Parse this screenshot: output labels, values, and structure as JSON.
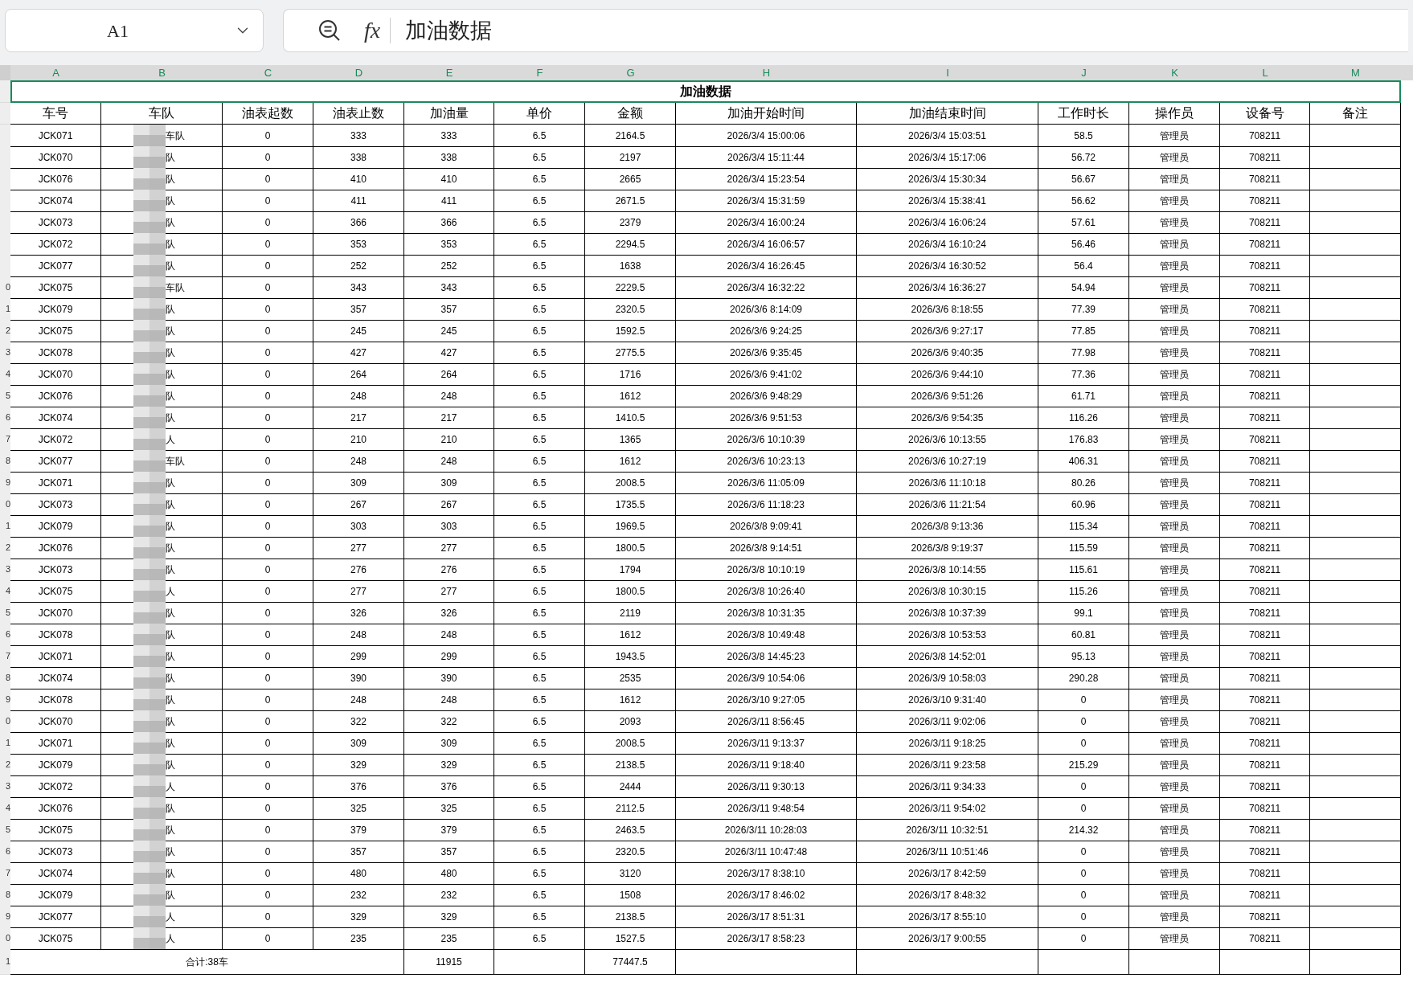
{
  "name_box": {
    "value": "A1"
  },
  "formula_bar": {
    "function_label": "fx",
    "value": "加油数据"
  },
  "column_letters": [
    {
      "label": "A",
      "selected": true
    },
    {
      "label": "B",
      "selected": true
    },
    {
      "label": "C",
      "selected": true
    },
    {
      "label": "D",
      "selected": true
    },
    {
      "label": "E",
      "selected": true
    },
    {
      "label": "F",
      "selected": true
    },
    {
      "label": "G",
      "selected": true
    },
    {
      "label": "H",
      "selected": true
    },
    {
      "label": "I",
      "selected": true
    },
    {
      "label": "J",
      "selected": true
    },
    {
      "label": "K",
      "selected": true
    },
    {
      "label": "L",
      "selected": true
    },
    {
      "label": "M",
      "selected": true
    }
  ],
  "title_row": {
    "text": "加油数据",
    "selected": true
  },
  "table": {
    "columns": [
      "车号",
      "车队",
      "油表起数",
      "油表止数",
      "加油量",
      "单价",
      "金额",
      "加油开始时间",
      "加油结束时间",
      "工作时长",
      "操作员",
      "设备号",
      "备注"
    ],
    "rows": [
      {
        "cells": [
          "JCK071",
          "车队",
          "0",
          "333",
          "333",
          "6.5",
          "2164.5",
          "2026/3/4 15:00:06",
          "2026/3/4 15:03:51",
          "58.5",
          "管理员",
          "708211"
        ]
      },
      {
        "cells": [
          "JCK070",
          "队",
          "0",
          "338",
          "338",
          "6.5",
          "2197",
          "2026/3/4 15:11:44",
          "2026/3/4 15:17:06",
          "56.72",
          "管理员",
          "708211"
        ]
      },
      {
        "cells": [
          "JCK076",
          "队",
          "0",
          "410",
          "410",
          "6.5",
          "2665",
          "2026/3/4 15:23:54",
          "2026/3/4 15:30:34",
          "56.67",
          "管理员",
          "708211"
        ]
      },
      {
        "cells": [
          "JCK074",
          "队",
          "0",
          "411",
          "411",
          "6.5",
          "2671.5",
          "2026/3/4 15:31:59",
          "2026/3/4 15:38:41",
          "56.62",
          "管理员",
          "708211"
        ]
      },
      {
        "cells": [
          "JCK073",
          "队",
          "0",
          "366",
          "366",
          "6.5",
          "2379",
          "2026/3/4 16:00:24",
          "2026/3/4 16:06:24",
          "57.61",
          "管理员",
          "708211"
        ]
      },
      {
        "cells": [
          "JCK072",
          "队",
          "0",
          "353",
          "353",
          "6.5",
          "2294.5",
          "2026/3/4 16:06:57",
          "2026/3/4 16:10:24",
          "56.46",
          "管理员",
          "708211"
        ]
      },
      {
        "cells": [
          "JCK077",
          "队",
          "0",
          "252",
          "252",
          "6.5",
          "1638",
          "2026/3/4 16:26:45",
          "2026/3/4 16:30:52",
          "56.4",
          "管理员",
          "708211"
        ]
      },
      {
        "row_label": "0",
        "cells": [
          "JCK075",
          "车队",
          "0",
          "343",
          "343",
          "6.5",
          "2229.5",
          "2026/3/4 16:32:22",
          "2026/3/4 16:36:27",
          "54.94",
          "管理员",
          "708211"
        ]
      },
      {
        "row_label": "1",
        "cells": [
          "JCK079",
          "队",
          "0",
          "357",
          "357",
          "6.5",
          "2320.5",
          "2026/3/6 8:14:09",
          "2026/3/6 8:18:55",
          "77.39",
          "管理员",
          "708211"
        ]
      },
      {
        "row_label": "2",
        "cells": [
          "JCK075",
          "队",
          "0",
          "245",
          "245",
          "6.5",
          "1592.5",
          "2026/3/6 9:24:25",
          "2026/3/6 9:27:17",
          "77.85",
          "管理员",
          "708211"
        ]
      },
      {
        "row_label": "3",
        "cells": [
          "JCK078",
          "队",
          "0",
          "427",
          "427",
          "6.5",
          "2775.5",
          "2026/3/6 9:35:45",
          "2026/3/6 9:40:35",
          "77.98",
          "管理员",
          "708211"
        ]
      },
      {
        "row_label": "4",
        "cells": [
          "JCK070",
          "队",
          "0",
          "264",
          "264",
          "6.5",
          "1716",
          "2026/3/6 9:41:02",
          "2026/3/6 9:44:10",
          "77.36",
          "管理员",
          "708211"
        ]
      },
      {
        "row_label": "5",
        "cells": [
          "JCK076",
          "队",
          "0",
          "248",
          "248",
          "6.5",
          "1612",
          "2026/3/6 9:48:29",
          "2026/3/6 9:51:26",
          "61.71",
          "管理员",
          "708211"
        ]
      },
      {
        "row_label": "6",
        "cells": [
          "JCK074",
          "队",
          "0",
          "217",
          "217",
          "6.5",
          "1410.5",
          "2026/3/6 9:51:53",
          "2026/3/6 9:54:35",
          "116.26",
          "管理员",
          "708211"
        ]
      },
      {
        "row_label": "7",
        "cells": [
          "JCK072",
          "人",
          "0",
          "210",
          "210",
          "6.5",
          "1365",
          "2026/3/6 10:10:39",
          "2026/3/6 10:13:55",
          "176.83",
          "管理员",
          "708211"
        ]
      },
      {
        "row_label": "8",
        "cells": [
          "JCK077",
          "车队",
          "0",
          "248",
          "248",
          "6.5",
          "1612",
          "2026/3/6 10:23:13",
          "2026/3/6 10:27:19",
          "406.31",
          "管理员",
          "708211"
        ]
      },
      {
        "row_label": "9",
        "cells": [
          "JCK071",
          "队",
          "0",
          "309",
          "309",
          "6.5",
          "2008.5",
          "2026/3/6 11:05:09",
          "2026/3/6 11:10:18",
          "80.26",
          "管理员",
          "708211"
        ]
      },
      {
        "row_label": "0",
        "cells": [
          "JCK073",
          "队",
          "0",
          "267",
          "267",
          "6.5",
          "1735.5",
          "2026/3/6 11:18:23",
          "2026/3/6 11:21:54",
          "60.96",
          "管理员",
          "708211"
        ]
      },
      {
        "row_label": "1",
        "cells": [
          "JCK079",
          "队",
          "0",
          "303",
          "303",
          "6.5",
          "1969.5",
          "2026/3/8 9:09:41",
          "2026/3/8 9:13:36",
          "115.34",
          "管理员",
          "708211"
        ]
      },
      {
        "row_label": "2",
        "cells": [
          "JCK076",
          "队",
          "0",
          "277",
          "277",
          "6.5",
          "1800.5",
          "2026/3/8 9:14:51",
          "2026/3/8 9:19:37",
          "115.59",
          "管理员",
          "708211"
        ]
      },
      {
        "row_label": "3",
        "cells": [
          "JCK073",
          "队",
          "0",
          "276",
          "276",
          "6.5",
          "1794",
          "2026/3/8 10:10:19",
          "2026/3/8 10:14:55",
          "115.61",
          "管理员",
          "708211"
        ]
      },
      {
        "row_label": "4",
        "cells": [
          "JCK075",
          "人",
          "0",
          "277",
          "277",
          "6.5",
          "1800.5",
          "2026/3/8 10:26:40",
          "2026/3/8 10:30:15",
          "115.26",
          "管理员",
          "708211"
        ]
      },
      {
        "row_label": "5",
        "cells": [
          "JCK070",
          "队",
          "0",
          "326",
          "326",
          "6.5",
          "2119",
          "2026/3/8 10:31:35",
          "2026/3/8 10:37:39",
          "99.1",
          "管理员",
          "708211"
        ]
      },
      {
        "row_label": "6",
        "cells": [
          "JCK078",
          "队",
          "0",
          "248",
          "248",
          "6.5",
          "1612",
          "2026/3/8 10:49:48",
          "2026/3/8 10:53:53",
          "60.81",
          "管理员",
          "708211"
        ]
      },
      {
        "row_label": "7",
        "cells": [
          "JCK071",
          "队",
          "0",
          "299",
          "299",
          "6.5",
          "1943.5",
          "2026/3/8 14:45:23",
          "2026/3/8 14:52:01",
          "95.13",
          "管理员",
          "708211"
        ]
      },
      {
        "row_label": "8",
        "cells": [
          "JCK074",
          "队",
          "0",
          "390",
          "390",
          "6.5",
          "2535",
          "2026/3/9 10:54:06",
          "2026/3/9 10:58:03",
          "290.28",
          "管理员",
          "708211"
        ]
      },
      {
        "row_label": "9",
        "cells": [
          "JCK078",
          "队",
          "0",
          "248",
          "248",
          "6.5",
          "1612",
          "2026/3/10 9:27:05",
          "2026/3/10 9:31:40",
          "0",
          "管理员",
          "708211"
        ]
      },
      {
        "row_label": "0",
        "cells": [
          "JCK070",
          "队",
          "0",
          "322",
          "322",
          "6.5",
          "2093",
          "2026/3/11 8:56:45",
          "2026/3/11 9:02:06",
          "0",
          "管理员",
          "708211"
        ]
      },
      {
        "row_label": "1",
        "cells": [
          "JCK071",
          "队",
          "0",
          "309",
          "309",
          "6.5",
          "2008.5",
          "2026/3/11 9:13:37",
          "2026/3/11 9:18:25",
          "0",
          "管理员",
          "708211"
        ]
      },
      {
        "row_label": "2",
        "cells": [
          "JCK079",
          "队",
          "0",
          "329",
          "329",
          "6.5",
          "2138.5",
          "2026/3/11 9:18:40",
          "2026/3/11 9:23:58",
          "215.29",
          "管理员",
          "708211"
        ]
      },
      {
        "row_label": "3",
        "cells": [
          "JCK072",
          "人",
          "0",
          "376",
          "376",
          "6.5",
          "2444",
          "2026/3/11 9:30:13",
          "2026/3/11 9:34:33",
          "0",
          "管理员",
          "708211"
        ]
      },
      {
        "row_label": "4",
        "cells": [
          "JCK076",
          "队",
          "0",
          "325",
          "325",
          "6.5",
          "2112.5",
          "2026/3/11 9:48:54",
          "2026/3/11 9:54:02",
          "0",
          "管理员",
          "708211"
        ]
      },
      {
        "row_label": "5",
        "cells": [
          "JCK075",
          "队",
          "0",
          "379",
          "379",
          "6.5",
          "2463.5",
          "2026/3/11 10:28:03",
          "2026/3/11 10:32:51",
          "214.32",
          "管理员",
          "708211"
        ]
      },
      {
        "row_label": "6",
        "cells": [
          "JCK073",
          "队",
          "0",
          "357",
          "357",
          "6.5",
          "2320.5",
          "2026/3/11 10:47:48",
          "2026/3/11 10:51:46",
          "0",
          "管理员",
          "708211"
        ]
      },
      {
        "row_label": "7",
        "cells": [
          "JCK074",
          "队",
          "0",
          "480",
          "480",
          "6.5",
          "3120",
          "2026/3/17 8:38:10",
          "2026/3/17 8:42:59",
          "0",
          "管理员",
          "708211"
        ]
      },
      {
        "row_label": "8",
        "cells": [
          "JCK079",
          "队",
          "0",
          "232",
          "232",
          "6.5",
          "1508",
          "2026/3/17 8:46:02",
          "2026/3/17 8:48:32",
          "0",
          "管理员",
          "708211"
        ]
      },
      {
        "row_label": "9",
        "cells": [
          "JCK077",
          "人",
          "0",
          "329",
          "329",
          "6.5",
          "2138.5",
          "2026/3/17 8:51:31",
          "2026/3/17 8:55:10",
          "0",
          "管理员",
          "708211"
        ]
      },
      {
        "row_label": "0",
        "cells": [
          "JCK075",
          "人",
          "0",
          "235",
          "235",
          "6.5",
          "1527.5",
          "2026/3/17 8:58:23",
          "2026/3/17 9:00:55",
          "0",
          "管理员",
          "708211"
        ]
      }
    ],
    "total_row": {
      "row_label": "1",
      "label": "合计:38车",
      "fuel_total": "11915",
      "amount_total": "77447.5"
    }
  }
}
